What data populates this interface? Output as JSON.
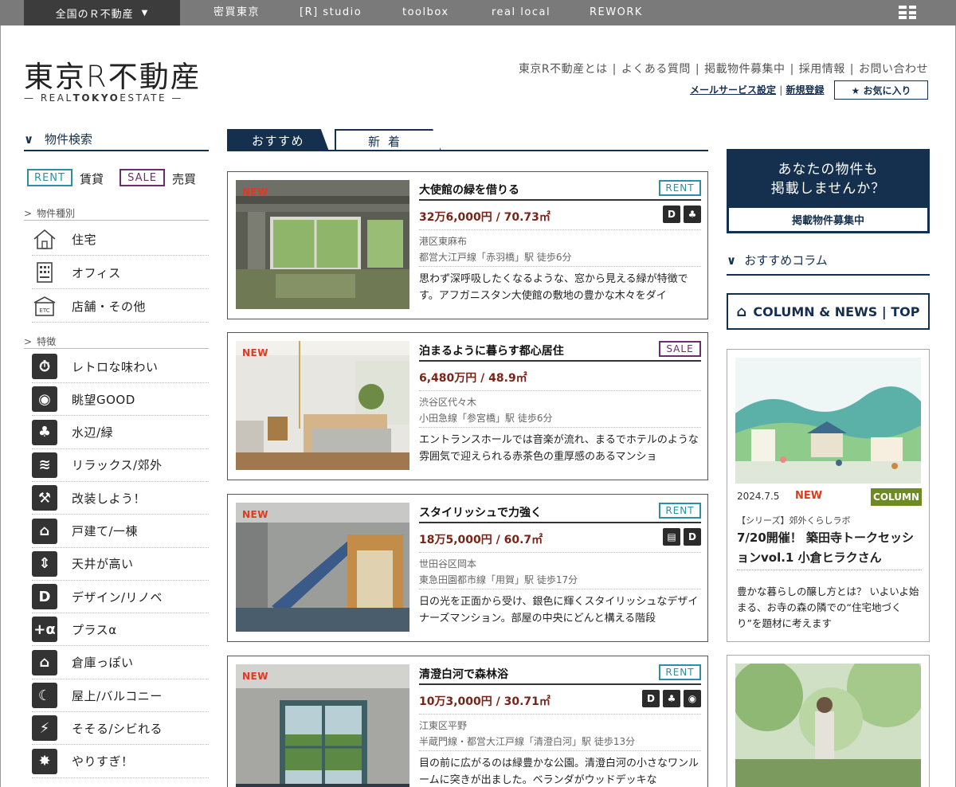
{
  "topbar": {
    "region_label": "全国のＲ不動産",
    "nav": [
      "密買東京",
      "[R] studio",
      "toolbox",
      "real local",
      "REWORK"
    ]
  },
  "header": {
    "logo": "東京R不動産",
    "logo_sub_prefix": "— REAL",
    "logo_sub_bold": "TOKYO",
    "logo_sub_suffix": "ESTATE —",
    "nav": [
      "東京R不動産とは",
      "よくある質問",
      "掲載物件募集中",
      "採用情報",
      "お問い合わせ"
    ],
    "mail_settings": "メールサービス設定",
    "register": "新規登録",
    "favorites": "★ お気に入り"
  },
  "sidebar": {
    "title": "物件検索",
    "rent_tag": "RENT",
    "rent_label": "賃貸",
    "sale_tag": "SALE",
    "sale_label": "売買",
    "type_heading": "物件種別",
    "types": [
      {
        "label": "住宅",
        "icon": "house-icon"
      },
      {
        "label": "オフィス",
        "icon": "office-icon"
      },
      {
        "label": "店舗・その他",
        "icon": "store-icon"
      }
    ],
    "feature_heading": "特徴",
    "features": [
      {
        "label": "レトロな味わい",
        "icon": "retro-icon",
        "glyph": "⏱"
      },
      {
        "label": "眺望GOOD",
        "icon": "view-icon",
        "glyph": "◉"
      },
      {
        "label": "水辺/緑",
        "icon": "waterside-icon",
        "glyph": "♣"
      },
      {
        "label": "リラックス/郊外",
        "icon": "relax-icon",
        "glyph": "≋"
      },
      {
        "label": "改装しよう！",
        "icon": "renovate-icon",
        "glyph": "⚒"
      },
      {
        "label": "戸建て/一棟",
        "icon": "building-icon",
        "glyph": "⌂"
      },
      {
        "label": "天井が高い",
        "icon": "high-ceiling-icon",
        "glyph": "⇕"
      },
      {
        "label": "デザイン/リノベ",
        "icon": "design-icon",
        "glyph": "D"
      },
      {
        "label": "プラスα",
        "icon": "plus-alpha-icon",
        "glyph": "+α"
      },
      {
        "label": "倉庫っぽい",
        "icon": "warehouse-icon",
        "glyph": "⌂"
      },
      {
        "label": "屋上/バルコニー",
        "icon": "rooftop-icon",
        "glyph": "☾"
      },
      {
        "label": "そそる/シビれる",
        "icon": "thrill-icon",
        "glyph": "⚡"
      },
      {
        "label": "やりすぎ！",
        "icon": "too-much-icon",
        "glyph": "✸"
      }
    ]
  },
  "tabs": {
    "recommend": "おすすめ",
    "new": "新着"
  },
  "listings": [
    {
      "new": "NEW",
      "title": "大使館の緑を借りる",
      "kind": "RENT",
      "price": "32万6,000円 / 70.73㎡",
      "icons": [
        "D",
        "♣"
      ],
      "area": "港区東麻布",
      "station": "都営大江戸線「赤羽橋」駅 徒歩6分",
      "desc": "思わず深呼吸したくなるような、窓から見える緑が特徴です。アフガニスタン大使館の敷地の豊かな木々をダイ"
    },
    {
      "new": "NEW",
      "title": "泊まるように暮らす都心居住",
      "kind": "SALE",
      "price": "6,480万円 / 48.9㎡",
      "icons": [],
      "area": "渋谷区代々木",
      "station": "小田急線「参宮橋」駅 徒歩6分",
      "desc": "エントランスホールでは音楽が流れ、まるでホテルのような雰囲気で迎えられる赤茶色の重厚感のあるマンショ"
    },
    {
      "new": "NEW",
      "title": "スタイリッシュで力強く",
      "kind": "RENT",
      "price": "18万5,000円 / 60.7㎡",
      "icons": [
        "▤",
        "D"
      ],
      "area": "世田谷区岡本",
      "station": "東急田園都市線「用賀」駅 徒歩17分",
      "desc": "日の光を正面から受け、銀色に輝くスタイリッシュなデザイナーズマンション。部屋の中央にどんと構える階段"
    },
    {
      "new": "NEW",
      "title": "清澄白河で森林浴",
      "kind": "RENT",
      "price": "10万3,000円 / 30.71㎡",
      "icons": [
        "D",
        "♣",
        "◉"
      ],
      "area": "江東区平野",
      "station": "半蔵門線・都営大江戸線「清澄白河」駅 徒歩13分",
      "desc": "目の前に広がるのは緑豊かな公園。清澄白河の小さなワンルームに突きが出ました。ベランダがウッドデッキな"
    }
  ],
  "right": {
    "ad_title_1": "あなたの物件も",
    "ad_title_2": "掲載しませんか？",
    "ad_button": "掲載物件募集中",
    "column_heading": "おすすめコラム",
    "column_news": "COLUMN & NEWS | TOP",
    "column": {
      "date": "2024.7.5",
      "new": "NEW",
      "tag": "COLUMN",
      "series": "【シリーズ】郊外くらしラボ",
      "title": "7/20開催！ 築田寺トークセッションvol.1 小倉ヒラクさん",
      "desc": "豊かな暮らしの醸し方とは？ いよいよ始まる、お寺の森の隣での“住宅地づくり”を題材に考えます"
    }
  }
}
